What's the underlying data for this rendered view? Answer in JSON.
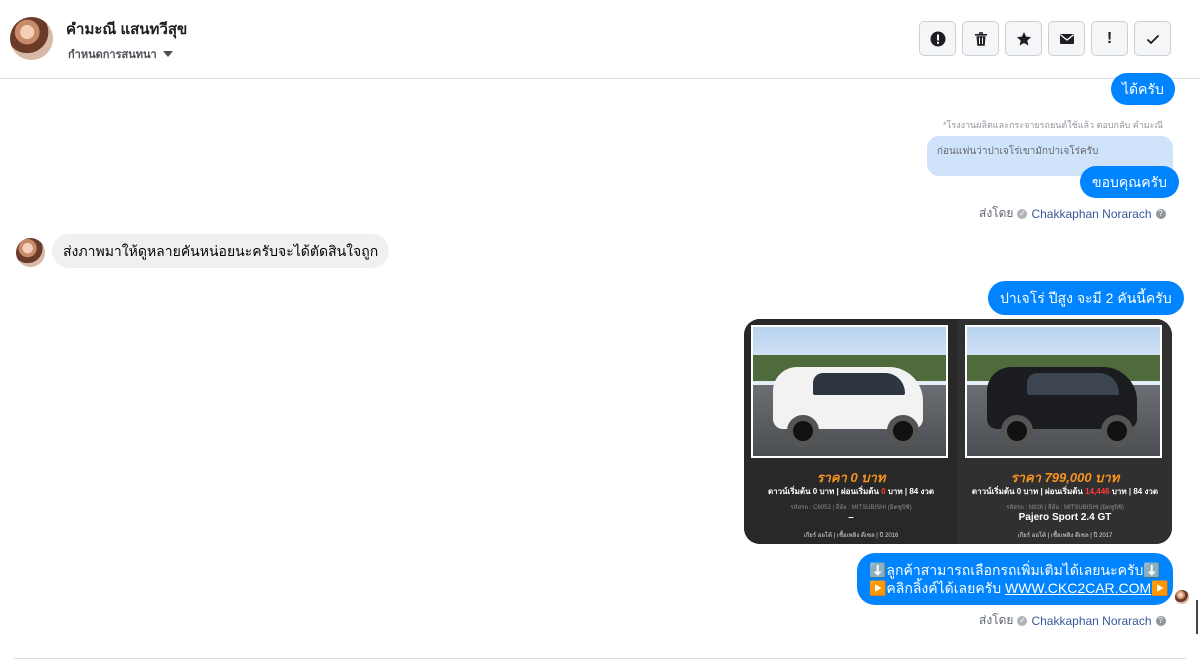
{
  "header": {
    "contact_name": "คำมะณี แสนทวีสุข",
    "conversation_setting": "กำหนดการสนทนา",
    "toolbar": [
      {
        "name": "spam-button",
        "icon": "alert-circle-icon",
        "glyph": "!"
      },
      {
        "name": "delete-button",
        "icon": "trash-icon",
        "glyph": ""
      },
      {
        "name": "star-button",
        "icon": "star-icon",
        "glyph": "★"
      },
      {
        "name": "unread-button",
        "icon": "envelope-icon",
        "glyph": "✉"
      },
      {
        "name": "follow-up-button",
        "icon": "exclamation-icon",
        "glyph": "!"
      },
      {
        "name": "done-button",
        "icon": "check-icon",
        "glyph": "✓"
      }
    ]
  },
  "messages": {
    "m1": "ได้ครับ",
    "reply_caption": "*โรงงานผลิตและกระจายรถยนต์ใช้แล้ว ตอบกลับ คำมะณี",
    "reply_quote": "ก่อนแฟนว่าปาเจโร่เขามักปาเจโร่ครับ",
    "m2": "ขอบคุณครับ",
    "sent_by_label": "ส่งโดย",
    "sent_by_name": "Chakkaphan Norarach",
    "m3_in": "ส่งภาพมาให้ดูหลายคันหน่อยนะครับจะได้ตัดสินใจถูก",
    "m4": "ปาเจโร่ ปีสูง จะมี 2 คันนี้ครับ",
    "link_line1": "⬇️ลูกค้าสามารถเลือกรถเพิ่มเติมได้เลยนะครับ⬇️",
    "link_line2_prefix": "▶️คลิกลิ้งค์ได้เลยครับ ",
    "link_url": "WWW.CKC2CAR.COM",
    "link_line2_suffix": "▶️"
  },
  "cards": {
    "left": {
      "price": "ราคา 0 บาท",
      "terms_a": "ดาวน์เริ่มต้น 0 บาท | ผ่อนเริ่มต้น ",
      "terms_red": "0",
      "terms_b": " บาท | 84 งวด",
      "meta": "รหัสรถ : C6053 | ยี่ห้อ : MITSUBISHI (มิตซูบิชิ)",
      "model": "–",
      "foot": "เกียร์ ออโต้ | เชื้อเพลิง ดีเซล | ปี 2016",
      "car_color": "#f2f2f2"
    },
    "right": {
      "price": "ราคา 799,000 บาท",
      "terms_a": "ดาวน์เริ่มต้น 0 บาท | ผ่อนเริ่มต้น ",
      "terms_red": "14,446",
      "terms_b": " บาท | 84 งวด",
      "meta": "รหัสรถ : N826 | ยี่ห้อ : MITSUBISHI (มิตซูบิชิ)",
      "model": "Pajero Sport 2.4 GT",
      "foot": "เกียร์ ออโต้ | เชื้อเพลิง ดีเซล | ปี 2017",
      "car_color": "#1a1c20"
    }
  }
}
